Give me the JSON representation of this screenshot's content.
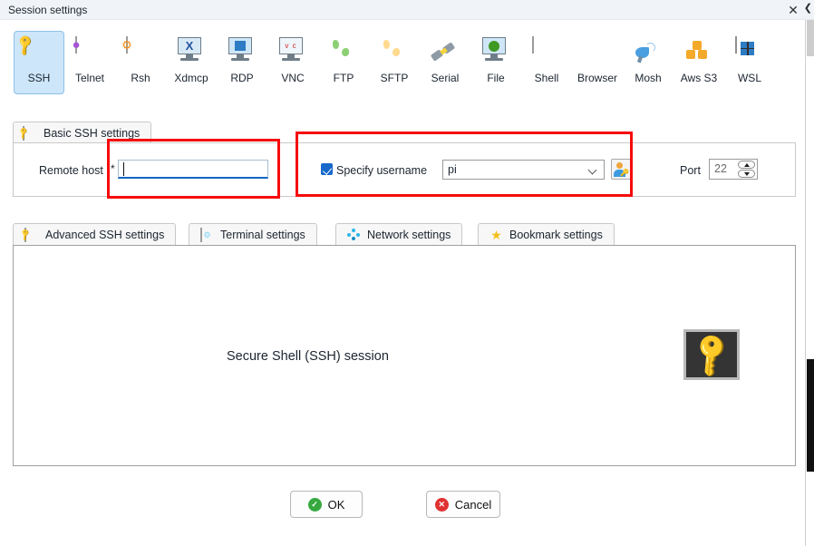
{
  "window": {
    "title": "Session settings",
    "close_label": "✕"
  },
  "session_types": [
    {
      "label": "SSH",
      "icon": "ssh-key-icon"
    },
    {
      "label": "Telnet",
      "icon": "telnet-cube-icon"
    },
    {
      "label": "Rsh",
      "icon": "rsh-gears-icon"
    },
    {
      "label": "Xdmcp",
      "icon": "xdmcp-monitor-icon"
    },
    {
      "label": "RDP",
      "icon": "rdp-windows-monitor-icon"
    },
    {
      "label": "VNC",
      "icon": "vnc-monitor-icon"
    },
    {
      "label": "FTP",
      "icon": "ftp-green-globe-icon"
    },
    {
      "label": "SFTP",
      "icon": "sftp-orange-globe-icon"
    },
    {
      "label": "Serial",
      "icon": "serial-plug-icon"
    },
    {
      "label": "File",
      "icon": "file-monitor-globe-icon"
    },
    {
      "label": "Shell",
      "icon": "shell-prompt-icon"
    },
    {
      "label": "Browser",
      "icon": "browser-globe-icon"
    },
    {
      "label": "Mosh",
      "icon": "mosh-satellite-icon"
    },
    {
      "label": "Aws S3",
      "icon": "aws-s3-cubes-icon"
    },
    {
      "label": "WSL",
      "icon": "wsl-windows-icon"
    }
  ],
  "selected_session_type": "SSH",
  "upper_tab": {
    "label": "Basic SSH settings",
    "icon": "ssh-key-icon"
  },
  "basic_settings": {
    "remote_host_label": "Remote host",
    "remote_host_required_marker": "*",
    "remote_host_value": "",
    "remote_host_placeholder": "",
    "specify_username_label": "Specify username",
    "specify_username_checked": true,
    "username_value": "pi",
    "username_browse_icon": "user-key-icon",
    "port_label": "Port",
    "port_value": "22"
  },
  "lower_tabs": [
    {
      "label": "Advanced SSH settings",
      "icon": "ssh-key-icon"
    },
    {
      "label": "Terminal settings",
      "icon": "terminal-gear-icon"
    },
    {
      "label": "Network settings",
      "icon": "network-dots-icon"
    },
    {
      "label": "Bookmark settings",
      "icon": "star-icon"
    }
  ],
  "content_panel": {
    "caption": "Secure Shell (SSH) session",
    "icon": "ssh-key-large-icon"
  },
  "footer": {
    "ok_label": "OK",
    "ok_badge": "✓",
    "cancel_label": "Cancel",
    "cancel_badge": "✕"
  },
  "annotations": [
    {
      "name": "remote-host-highlight",
      "color": "#f60b0b"
    },
    {
      "name": "username-highlight",
      "color": "#f60b0b"
    }
  ],
  "colors": {
    "titlebar_bg": "#f0f4f8",
    "selected_tile_bg": "#cde6f9",
    "selected_tile_border": "#8dc1e8",
    "focus_underline": "#1565c0",
    "checkbox_blue": "#1668c9",
    "annotation_red": "#f60b0b",
    "ok_green": "#36a83f",
    "cancel_red": "#e03131",
    "key_yellow": "#fdc71b"
  }
}
